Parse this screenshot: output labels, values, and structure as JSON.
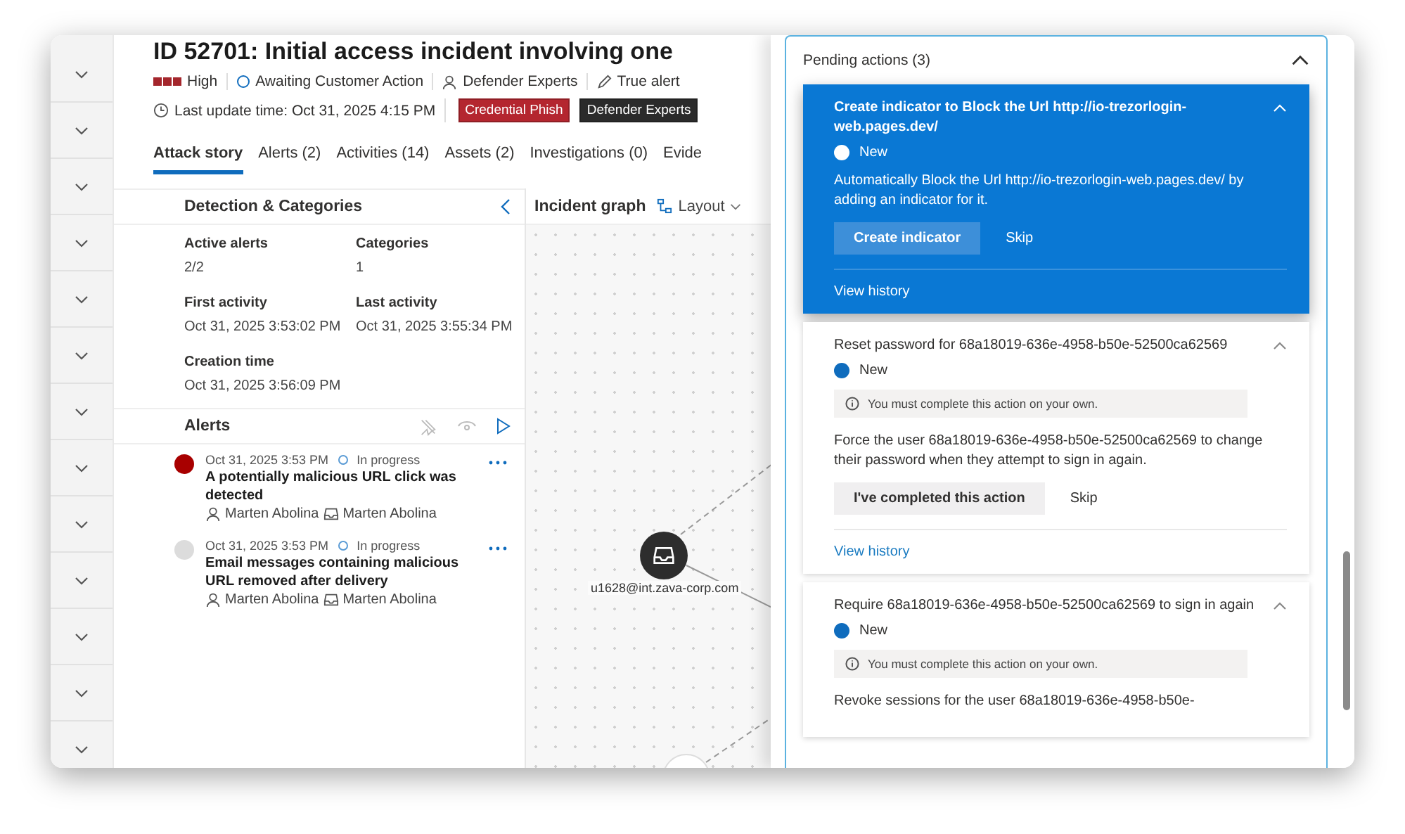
{
  "rail": {
    "items": [
      {
        "expanded": false
      },
      {
        "expanded": false
      },
      {
        "expanded": false
      },
      {
        "expanded": false
      },
      {
        "expanded": false
      },
      {
        "expanded": false
      },
      {
        "expanded": false
      },
      {
        "expanded": false
      },
      {
        "expanded": false
      },
      {
        "expanded": false
      },
      {
        "expanded": false
      },
      {
        "expanded": false
      },
      {
        "expanded": false
      }
    ]
  },
  "incident": {
    "title": "ID 52701: Initial access incident involving one",
    "severity": {
      "label": "High",
      "level": 1
    },
    "status": "Awaiting Customer Action",
    "assigned_to": "Defender Experts",
    "classification": "True alert",
    "last_update": "Last update time: Oct 31, 2025 4:15 PM",
    "tags": [
      {
        "label": "Credential Phish",
        "color": "#b4262f"
      },
      {
        "label": "Defender Experts",
        "color": "#2b2b2b"
      }
    ]
  },
  "tabs": [
    {
      "label": "Attack story",
      "selected": true
    },
    {
      "label": "Alerts (2)",
      "selected": false
    },
    {
      "label": "Activities (14)",
      "selected": false
    },
    {
      "label": "Assets (2)",
      "selected": false
    },
    {
      "label": "Investigations (0)",
      "selected": false
    },
    {
      "label": "Evide",
      "selected": false
    }
  ],
  "detection": {
    "title": "Detection & Categories",
    "fields": [
      {
        "label": "Active alerts",
        "value": "2/2"
      },
      {
        "label": "Categories",
        "value": "1"
      },
      {
        "label": "First activity",
        "value": "Oct 31, 2025 3:53:02 PM"
      },
      {
        "label": "Last activity",
        "value": "Oct 31, 2025 3:55:34 PM"
      },
      {
        "label": "Creation time",
        "value": "Oct 31, 2025 3:56:09 PM"
      }
    ]
  },
  "alerts": {
    "title": "Alerts",
    "items": [
      {
        "time": "Oct 31, 2025 3:53 PM",
        "status": "In progress",
        "title": "A potentially malicious URL click was detected",
        "user": "Marten Abolina",
        "mailbox": "Marten Abolina",
        "color": "#a80000"
      },
      {
        "time": "Oct 31, 2025 3:53 PM",
        "status": "In progress",
        "title": "Email messages containing malicious URL removed after delivery",
        "user": "Marten Abolina",
        "mailbox": "Marten Abolina",
        "color": "#dcdcdc"
      }
    ]
  },
  "graph": {
    "title": "Incident graph",
    "layout_label": "Layout",
    "node_label": "u1628@int.zava-corp.com"
  },
  "pending": {
    "title": "Pending actions (3)",
    "expanded": true,
    "actions": [
      {
        "selected": true,
        "expanded": true,
        "title": "Create indicator to Block the Url http://io-trezorlogin-web.pages.dev/",
        "status": "New",
        "description": "Automatically Block the Url http://io-trezorlogin-web.pages.dev/ by adding an indicator for it.",
        "primary": "Create indicator",
        "secondary": "Skip",
        "history": "View history"
      },
      {
        "selected": false,
        "expanded": true,
        "title": "Reset password for 68a18019-636e-4958-b50e-52500ca62569",
        "status": "New",
        "note": "You must complete this action on your own.",
        "description": "Force the user 68a18019-636e-4958-b50e-52500ca62569 to change their password when they attempt to sign in again.",
        "primary": "I've completed this action",
        "secondary": "Skip",
        "history": "View history"
      },
      {
        "selected": false,
        "expanded": true,
        "title": "Require 68a18019-636e-4958-b50e-52500ca62569 to sign in again",
        "status": "New",
        "note": "You must complete this action on your own.",
        "description": "Revoke sessions for the user 68a18019-636e-4958-b50e-"
      }
    ]
  }
}
